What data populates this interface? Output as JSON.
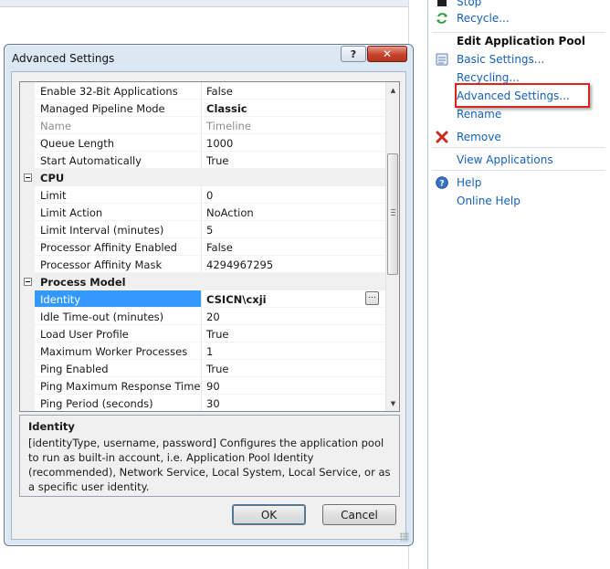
{
  "actions_pane": {
    "items_top": [
      {
        "label": "Stop",
        "icon": "stop-icon"
      },
      {
        "label": "Recycle...",
        "icon": "recycle-icon"
      }
    ],
    "section_heading": "Edit Application Pool",
    "edit_items": [
      {
        "label": "Basic Settings...",
        "icon": "settings-icon"
      },
      {
        "label": "Recycling...",
        "icon": ""
      },
      {
        "label": "Advanced Settings...",
        "icon": ""
      },
      {
        "label": "Rename",
        "icon": ""
      }
    ],
    "remove": {
      "label": "Remove",
      "icon": "remove-icon"
    },
    "view_applications": {
      "label": "View Applications"
    },
    "help": {
      "label": "Help",
      "icon": "help-icon"
    },
    "online_help": {
      "label": "Online Help"
    },
    "link_color": "#1560bd",
    "highlight_color": "#d9261c"
  },
  "dialog": {
    "title": "Advanced Settings",
    "help_button": "?",
    "close_button": "✕",
    "grid_rows": [
      {
        "type": "prop",
        "name": "Enable 32-Bit Applications",
        "value": "False"
      },
      {
        "type": "prop",
        "name": "Managed Pipeline Mode",
        "value": "Classic",
        "value_bold": true
      },
      {
        "type": "prop",
        "name": "Name",
        "value": "Timeline",
        "dim": true
      },
      {
        "type": "prop",
        "name": "Queue Length",
        "value": "1000"
      },
      {
        "type": "prop",
        "name": "Start Automatically",
        "value": "True"
      },
      {
        "type": "category",
        "name": "CPU"
      },
      {
        "type": "prop",
        "name": "Limit",
        "value": "0"
      },
      {
        "type": "prop",
        "name": "Limit Action",
        "value": "NoAction"
      },
      {
        "type": "prop",
        "name": "Limit Interval (minutes)",
        "value": "5"
      },
      {
        "type": "prop",
        "name": "Processor Affinity Enabled",
        "value": "False"
      },
      {
        "type": "prop",
        "name": "Processor Affinity Mask",
        "value": "4294967295"
      },
      {
        "type": "category",
        "name": "Process Model"
      },
      {
        "type": "prop",
        "name": "Identity",
        "value": "CSICN\\cxji",
        "value_bold": true,
        "selected": true,
        "ellipsis": "..."
      },
      {
        "type": "prop",
        "name": "Idle Time-out (minutes)",
        "value": "20"
      },
      {
        "type": "prop",
        "name": "Load User Profile",
        "value": "True"
      },
      {
        "type": "prop",
        "name": "Maximum Worker Processes",
        "value": "1"
      },
      {
        "type": "prop",
        "name": "Ping Enabled",
        "value": "True"
      },
      {
        "type": "prop",
        "name": "Ping Maximum Response Time (s",
        "value": "90"
      },
      {
        "type": "prop",
        "name": "Ping Period (seconds)",
        "value": "30"
      }
    ],
    "description": {
      "title": "Identity",
      "body": "[identityType, username, password] Configures the application pool to run as built-in account, i.e. Application Pool Identity (recommended), Network Service, Local System, Local Service, or as a specific user identity."
    },
    "ok_label": "OK",
    "cancel_label": "Cancel",
    "selection_color": "#3399ff"
  }
}
